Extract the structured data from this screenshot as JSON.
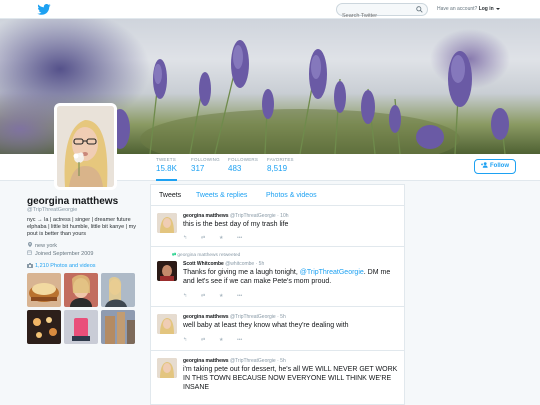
{
  "topbar": {
    "search_placeholder": "Search Twitter",
    "account_prompt": "Have an account?",
    "login_label": "Log in"
  },
  "profile": {
    "name": "georgina matthews",
    "handle": "@TripThreatGeorgie",
    "bio": "nyc → la | actress | singer | dreamer future elphaba | little bit humble, little bit kanye | my pout is better than yours",
    "location": "new york",
    "joined": "Joined September 2009",
    "photos_label": "1,210 Photos and videos"
  },
  "stats": [
    {
      "label": "TWEETS",
      "value": "15.8K"
    },
    {
      "label": "FOLLOWING",
      "value": "317"
    },
    {
      "label": "FOLLOWERS",
      "value": "483"
    },
    {
      "label": "FAVORITES",
      "value": "8,519"
    }
  ],
  "follow_label": "Follow",
  "tabs": [
    "Tweets",
    "Tweets & replies",
    "Photos & videos"
  ],
  "tweets": [
    {
      "name": "georgina matthews",
      "handle": "@TripThreatGeorgie",
      "time": "10h",
      "text": "this is the best day of my trash life"
    },
    {
      "retweet_note": "georgina matthews retweeted",
      "name": "Scott Whitcombe",
      "handle": "@whitcombe",
      "time": "5h",
      "text_before": "Thanks for giving me a laugh tonight, ",
      "mention": "@TripThreatGeorgie",
      "text_after": ". DM me and let's see if we can make Pete's mom proud."
    },
    {
      "name": "georgina matthews",
      "handle": "@TripThreatGeorgie",
      "time": "5h",
      "text": "well baby at least they know what they're dealing with"
    },
    {
      "name": "georgina matthews",
      "handle": "@TripThreatGeorgie",
      "time": "5h",
      "text": "i'm taking pete out for dessert, he's all WE WILL NEVER GET WORK IN THIS TOWN BECAUSE NOW EVERYONE WILL THINK WE'RE INSANE"
    }
  ],
  "icons": {
    "brand": "twitter-bird-icon",
    "accent": "#1da1f2",
    "retweet_color": "#19cf86"
  }
}
